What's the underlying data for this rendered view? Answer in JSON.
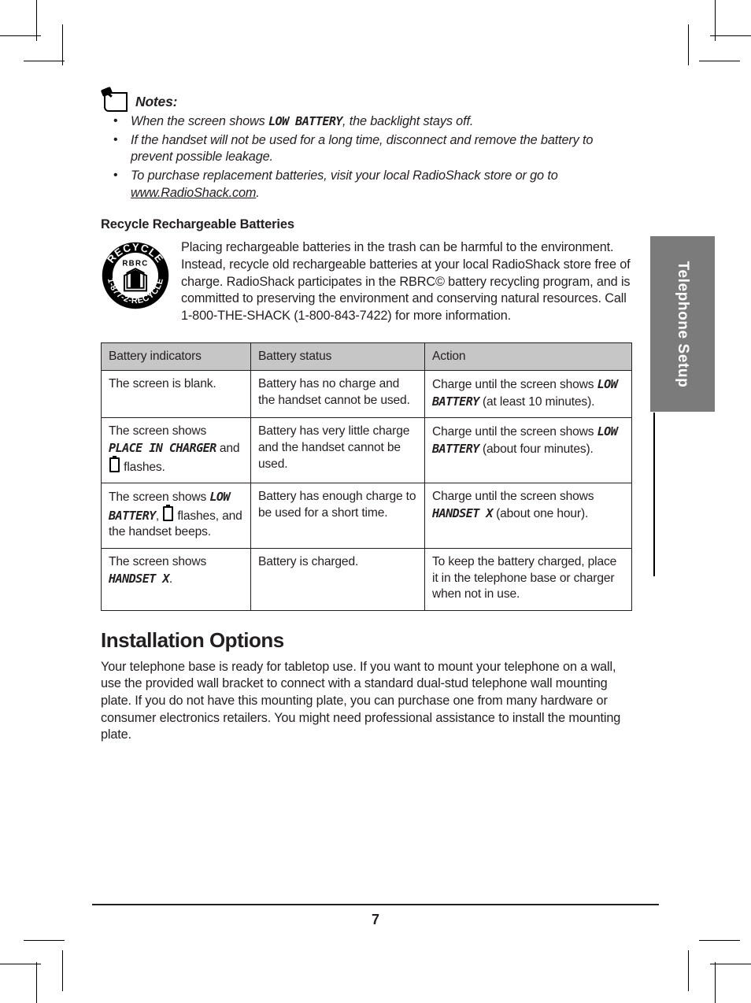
{
  "notes": {
    "icon": "note-pin-icon",
    "title": "Notes:",
    "items": [
      {
        "pre": "When the screen shows ",
        "lcd": "LOW BATTERY",
        "post": ", the backlight stays off."
      },
      {
        "pre": "If the handset will not be used for a long time, disconnect and remove the battery to prevent possible leakage.",
        "lcd": "",
        "post": ""
      },
      {
        "pre": "To purchase replacement batteries, visit your local RadioShack store or go to ",
        "link": "www.RadioShack.com",
        "post": "."
      }
    ]
  },
  "recycle": {
    "heading": "Recycle Rechargeable Batteries",
    "logo": {
      "name": "rbrc-recycle-logo",
      "top_arc": "RECYCLE",
      "center": "RBRC",
      "bottom_arc": "1-877-2-RECYCLE"
    },
    "paragraph": "Placing rechargeable batteries in the trash can be harmful to the environment. Instead, recycle old rechargeable batteries at your local RadioShack store free of charge. RadioShack participates in the RBRC© battery recycling program, and is committed to preserving the environment and conserving natural resources. Call 1-800-THE-SHACK (1-800-843-7422) for more information."
  },
  "battery_table": {
    "headers": [
      "Battery indicators",
      "Battery status",
      "Action"
    ],
    "rows": [
      {
        "indicator": {
          "pre": "The screen is blank.",
          "lcd": "",
          "post": ""
        },
        "status": "Battery has no charge and the handset cannot be used.",
        "action": {
          "pre": "Charge until the screen shows ",
          "lcd": "LOW BATTERY",
          "post": " (at least 10 minutes)."
        }
      },
      {
        "indicator": {
          "pre": "The screen shows ",
          "lcd": "PLACE IN CHARGER",
          "mid": " and ",
          "post": " flashes."
        },
        "status": "Battery has very little charge and the handset cannot be used.",
        "action": {
          "pre": "Charge until the screen shows ",
          "lcd": "LOW BATTERY",
          "post": " (about four minutes)."
        }
      },
      {
        "indicator": {
          "pre": "The screen shows ",
          "lcd": "LOW BATTERY",
          "mid": ", ",
          "post": " flashes, and the handset beeps."
        },
        "status": "Battery has enough charge to be used for a short time.",
        "action": {
          "pre": "Charge until the screen shows ",
          "lcd": "HANDSET X",
          "post": " (about one hour)."
        }
      },
      {
        "indicator": {
          "pre": "The screen shows ",
          "lcd": "HANDSET X",
          "post": "."
        },
        "status": "Battery is charged.",
        "action": {
          "pre": "To keep the battery charged, place it in the telephone base or charger when not in use.",
          "lcd": "",
          "post": ""
        }
      }
    ]
  },
  "installation": {
    "heading": "Installation Options",
    "paragraph": "Your telephone base is ready for tabletop use. If you want to mount your telephone on a wall, use the provided wall bracket to connect with a standard dual-stud telephone wall mounting plate. If you do not have this mounting plate, you can purchase one from many hardware or consumer electronics retailers. You might need professional assistance to install the mounting plate."
  },
  "side_tab": {
    "label": "Telephone Setup",
    "background": "#7b7b7b",
    "text_color": "#ffffff"
  },
  "footer": {
    "page_number": "7"
  }
}
